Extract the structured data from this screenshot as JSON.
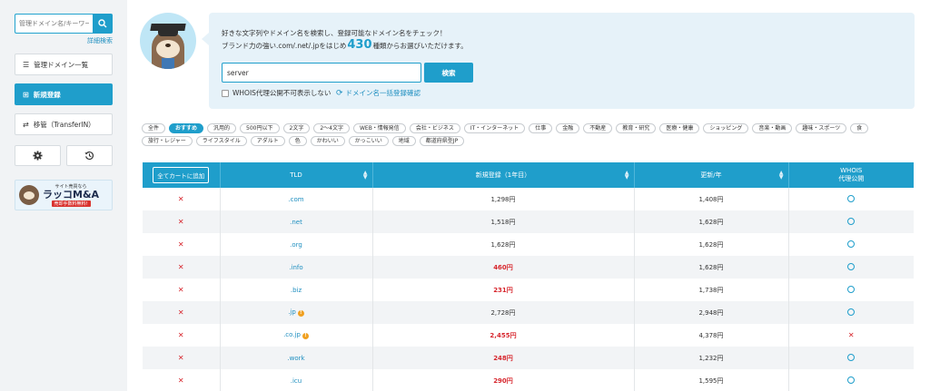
{
  "sidebar": {
    "search_placeholder": "管理ドメイン名/キーワード",
    "advanced_search": "詳細検索",
    "nav": [
      {
        "label": "管理ドメイン一覧",
        "icon": "list-icon"
      },
      {
        "label": "新規登録",
        "icon": "plus-square-icon"
      },
      {
        "label": "移管（TransferIN）",
        "icon": "transfer-arrows-icon"
      }
    ],
    "icon_buttons": [
      "gear-icon",
      "history-icon"
    ],
    "banner": {
      "top": "サイト売買なら",
      "main": "ラッコM&A",
      "sub": "売却手数料無料!"
    }
  },
  "header": {
    "line1": "好きな文字列やドメイン名を検索し、登録可能なドメイン名をチェック！",
    "line2_prefix": "ブランド力の強い.com/.net/.jpをはじめ",
    "line2_count": "430",
    "line2_suffix": "種類からお選びいただけます。",
    "search_value": "server",
    "search_button": "検索",
    "whois_checkbox": "WHOIS代理公開不可表示しない",
    "bulk_link": "ドメイン名一括登録確認"
  },
  "categories": [
    "全件",
    "おすすめ",
    "汎用的",
    "500円以下",
    "2文字",
    "2〜4文字",
    "WEB・情報発信",
    "会社・ビジネス",
    "IT・インターネット",
    "仕事",
    "金融",
    "不動産",
    "教育・研究",
    "医療・健康",
    "ショッピング",
    "音楽・動画",
    "趣味・スポーツ",
    "食",
    "旅行・レジャー",
    "ライフスタイル",
    "アダルト",
    "色",
    "かわいい",
    "かっこいい",
    "地域",
    "都道府県型JP"
  ],
  "active_category": "おすすめ",
  "table": {
    "headers": {
      "cart_all": "全てカートに追加",
      "tld": "TLD",
      "new_reg": "新規登録（1年目）",
      "renewal": "更新/年",
      "whois_line1": "WHOIS",
      "whois_line2": "代理公開"
    },
    "rows": [
      {
        "tld": ".com",
        "price": "1,298円",
        "sale": false,
        "renew": "1,408円",
        "whois": "o",
        "info": false
      },
      {
        "tld": ".net",
        "price": "1,518円",
        "sale": false,
        "renew": "1,628円",
        "whois": "o",
        "info": false
      },
      {
        "tld": ".org",
        "price": "1,628円",
        "sale": false,
        "renew": "1,628円",
        "whois": "o",
        "info": false
      },
      {
        "tld": ".info",
        "price": "460円",
        "sale": true,
        "renew": "1,628円",
        "whois": "o",
        "info": false
      },
      {
        "tld": ".biz",
        "price": "231円",
        "sale": true,
        "renew": "1,738円",
        "whois": "o",
        "info": false
      },
      {
        "tld": ".jp",
        "price": "2,728円",
        "sale": false,
        "renew": "2,948円",
        "whois": "o",
        "info": true
      },
      {
        "tld": ".co.jp",
        "price": "2,455円",
        "sale": true,
        "renew": "4,378円",
        "whois": "x",
        "info": true
      },
      {
        "tld": ".work",
        "price": "248円",
        "sale": true,
        "renew": "1,232円",
        "whois": "o",
        "info": false
      },
      {
        "tld": ".icu",
        "price": "290円",
        "sale": true,
        "renew": "1,595円",
        "whois": "o",
        "info": false
      }
    ]
  },
  "colors": {
    "accent": "#1f9ecb",
    "sale": "#d7262d",
    "panel": "#e6f2f9",
    "sidebar": "#f1f3f5"
  }
}
